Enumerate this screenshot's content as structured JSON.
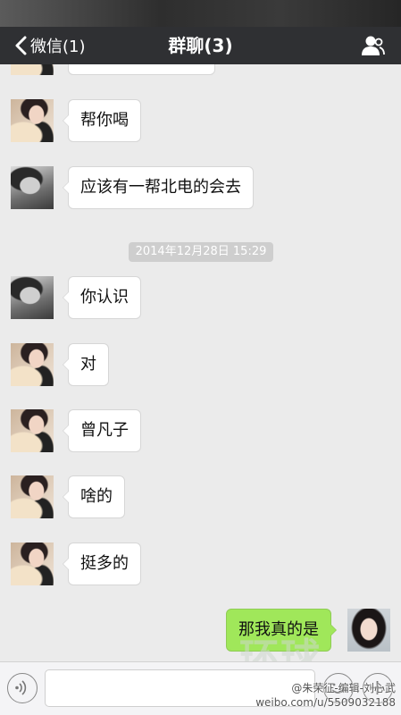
{
  "nav": {
    "back_label": "微信(1)",
    "title": "群聊(3)"
  },
  "messages": [
    {
      "sender": "girl",
      "text": ""
    },
    {
      "sender": "girl",
      "text": "帮你喝"
    },
    {
      "sender": "bw",
      "text": "应该有一帮北电的会去"
    },
    {
      "sender": "bw",
      "text": "你认识"
    },
    {
      "sender": "girl",
      "text": "对"
    },
    {
      "sender": "girl",
      "text": "曾凡子"
    },
    {
      "sender": "girl",
      "text": "啥的"
    },
    {
      "sender": "girl",
      "text": "挺多的"
    },
    {
      "sender": "self",
      "text": "那我真的是"
    }
  ],
  "timestamp": "2014年12月28日 15:29",
  "input": {
    "value": ""
  },
  "watermark": {
    "logo": "环球",
    "line1": "@朱荣征-编辑-刘心武",
    "line2": "weibo.com/u/5509032188"
  },
  "colors": {
    "navbar": "#2f3033",
    "chat_bg": "#ebebeb",
    "my_bubble": "#a0e75a",
    "other_bubble": "#ffffff"
  }
}
